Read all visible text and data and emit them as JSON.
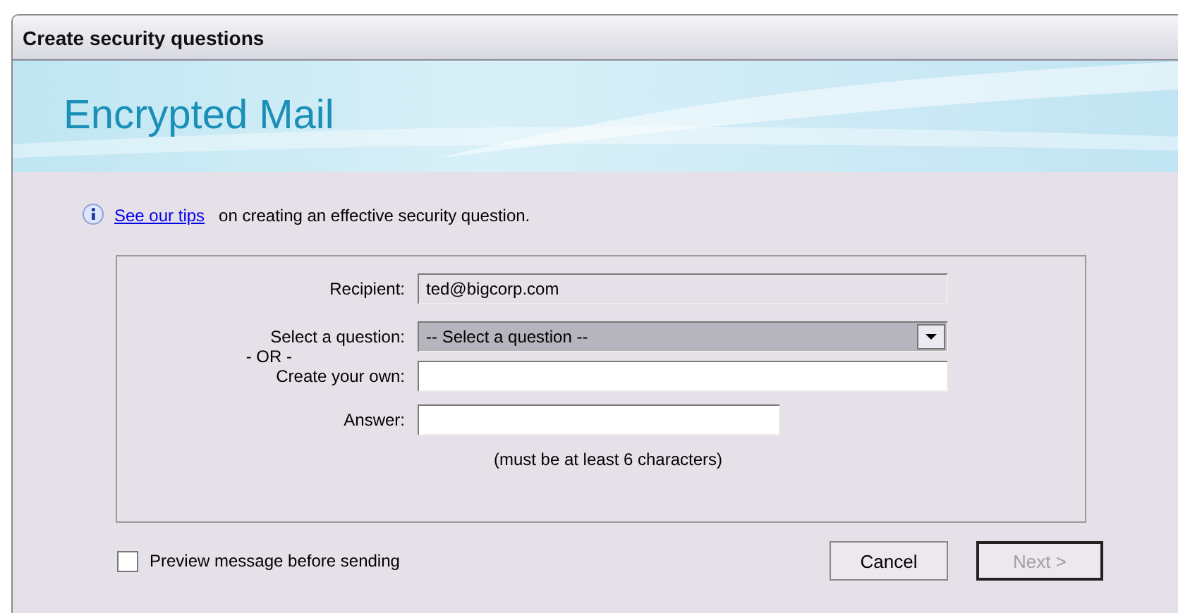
{
  "window": {
    "title": "Create security questions"
  },
  "banner": {
    "title": "Encrypted Mail"
  },
  "tip": {
    "link": "See our tips",
    "text": "on creating an effective security question."
  },
  "form": {
    "recipient": {
      "label": "Recipient:",
      "value": "ted@bigcorp.com"
    },
    "question": {
      "label": "Select a question:",
      "value": "-- Select a question --"
    },
    "or": "- OR -",
    "own": {
      "label": "Create your own:"
    },
    "answer": {
      "label": "Answer:",
      "hint": "(must be at least 6 characters)"
    }
  },
  "preview": {
    "label": "Preview message before sending",
    "checked": false
  },
  "buttons": [
    {
      "label": "Cancel",
      "disabled": false
    },
    {
      "label": "Next >",
      "disabled": true
    }
  ]
}
